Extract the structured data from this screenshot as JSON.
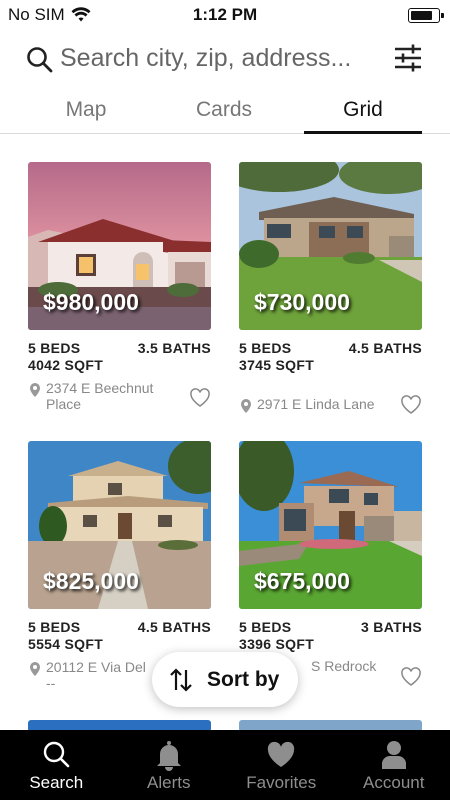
{
  "status_bar": {
    "carrier": "No SIM",
    "time": "1:12 PM",
    "battery_level": 0.7
  },
  "search": {
    "placeholder": "Search city, zip, address...",
    "icon": "search-icon",
    "filter_icon": "sliders-icon"
  },
  "tabs": [
    {
      "label": "Map",
      "active": false
    },
    {
      "label": "Cards",
      "active": false
    },
    {
      "label": "Grid",
      "active": true
    }
  ],
  "listings": [
    {
      "price": "$980,000",
      "beds": "5 BEDS",
      "baths": "3.5 BATHS",
      "sqft": "4042 SQFT",
      "address": "2374 E Beechnut Place"
    },
    {
      "price": "$730,000",
      "beds": "5 BEDS",
      "baths": "4.5 BATHS",
      "sqft": "3745 SQFT",
      "address": "2971 E Linda Lane"
    },
    {
      "price": "$825,000",
      "beds": "5 BEDS",
      "baths": "4.5 BATHS",
      "sqft": "5554 SQFT",
      "address": "20112 E Via Del --"
    },
    {
      "price": "$675,000",
      "beds": "5 BEDS",
      "baths": "3 BATHS",
      "sqft": "3396 SQFT",
      "address": "S Redrock"
    }
  ],
  "sort_button": {
    "label": "Sort by",
    "icon": "sort-arrows-icon"
  },
  "bottom_nav": [
    {
      "label": "Search",
      "icon": "search-icon",
      "active": true
    },
    {
      "label": "Alerts",
      "icon": "bell-icon",
      "active": false
    },
    {
      "label": "Favorites",
      "icon": "heart-icon",
      "active": false
    },
    {
      "label": "Account",
      "icon": "person-icon",
      "active": false
    }
  ],
  "colors": {
    "accent": "#111111",
    "nav_background": "#000000",
    "inactive": "#8e8e8e"
  }
}
